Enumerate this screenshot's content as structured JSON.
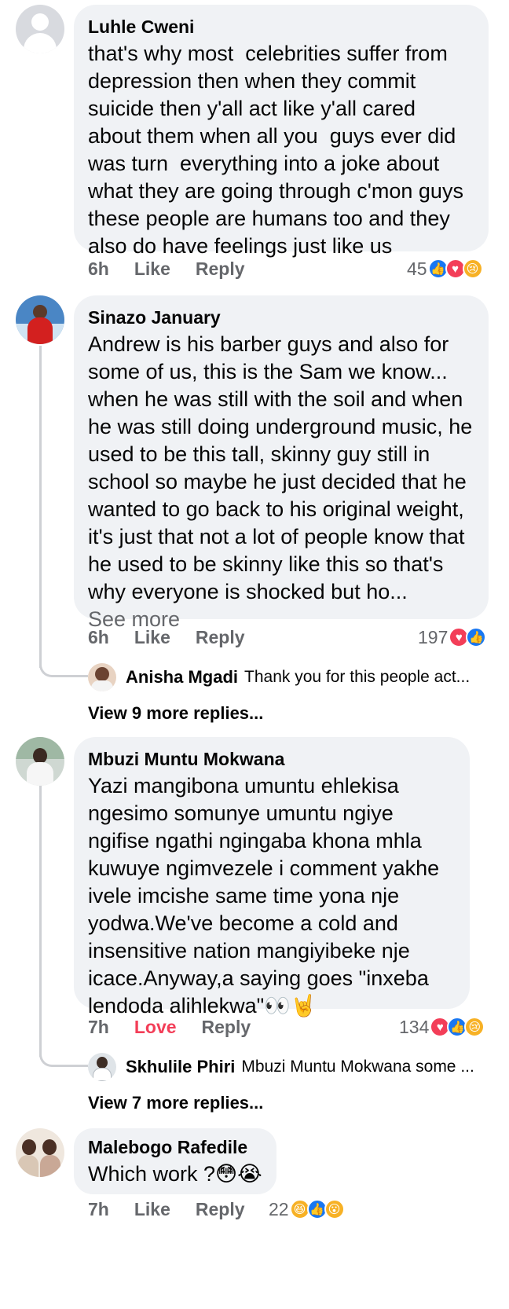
{
  "comments": [
    {
      "author": "Luhle Cweni",
      "text": "that's why most  celebrities suffer from depression then when they commit suicide then y'all act like y'all cared about them when all you  guys ever did was turn  everything into a joke about what they are going through c'mon guys these people are humans too and they also do have feelings just like us",
      "time": "6h",
      "like_label": "Like",
      "reply_label": "Reply",
      "reaction_count": "45",
      "reactions": [
        "like-icon",
        "heart-icon",
        "sad-icon"
      ]
    },
    {
      "author": "Sinazo January",
      "text": "Andrew is his barber guys and also for some of us, this is the Sam we know... when he was still with the soil and when he was still doing underground music, he used to be this tall, skinny guy still in school so maybe he just decided that he wanted to go back to his original weight, it's just that not a lot of people know that he used to be skinny like this so that's why everyone is shocked but ho...",
      "see_more": "See more",
      "time": "6h",
      "like_label": "Like",
      "reply_label": "Reply",
      "reaction_count": "197",
      "reactions": [
        "heart-icon",
        "like-icon"
      ],
      "reply_preview": {
        "author": "Anisha Mgadi",
        "text": "Thank you for this people act..."
      },
      "more_replies": "View 9 more replies..."
    },
    {
      "author": "Mbuzi Muntu Mokwana",
      "text": "Yazi mangibona umuntu ehlekisa ngesimo somunye umuntu ngiye ngifise ngathi ngingaba khona mhla kuwuye ngimvezele i comment yakhe ivele imcishe same time yona nje yodwa.We've become a cold and insensitive nation mangiyibeke nje icace.Anyway,a saying goes \"inxeba lendoda alihlekwa\"👀🤘",
      "time": "7h",
      "like_label": "Love",
      "reply_label": "Reply",
      "reaction_count": "134",
      "reactions": [
        "heart-icon",
        "like-icon",
        "sad-icon"
      ],
      "reply_preview": {
        "author": "Skhulile Phiri",
        "text": "Mbuzi Muntu Mokwana some ..."
      },
      "more_replies": "View 7 more replies..."
    },
    {
      "author": "Malebogo Rafedile",
      "text": "Which work ?😳😭",
      "time": "7h",
      "like_label": "Like",
      "reply_label": "Reply",
      "reaction_count": "22",
      "reactions": [
        "haha-icon",
        "like-icon",
        "wow-icon"
      ]
    }
  ],
  "colors": {
    "bubble": "#f0f2f5",
    "secondary_text": "#65676b",
    "love": "#f33e58",
    "like": "#1877f2",
    "thread": "#ced0d4"
  }
}
